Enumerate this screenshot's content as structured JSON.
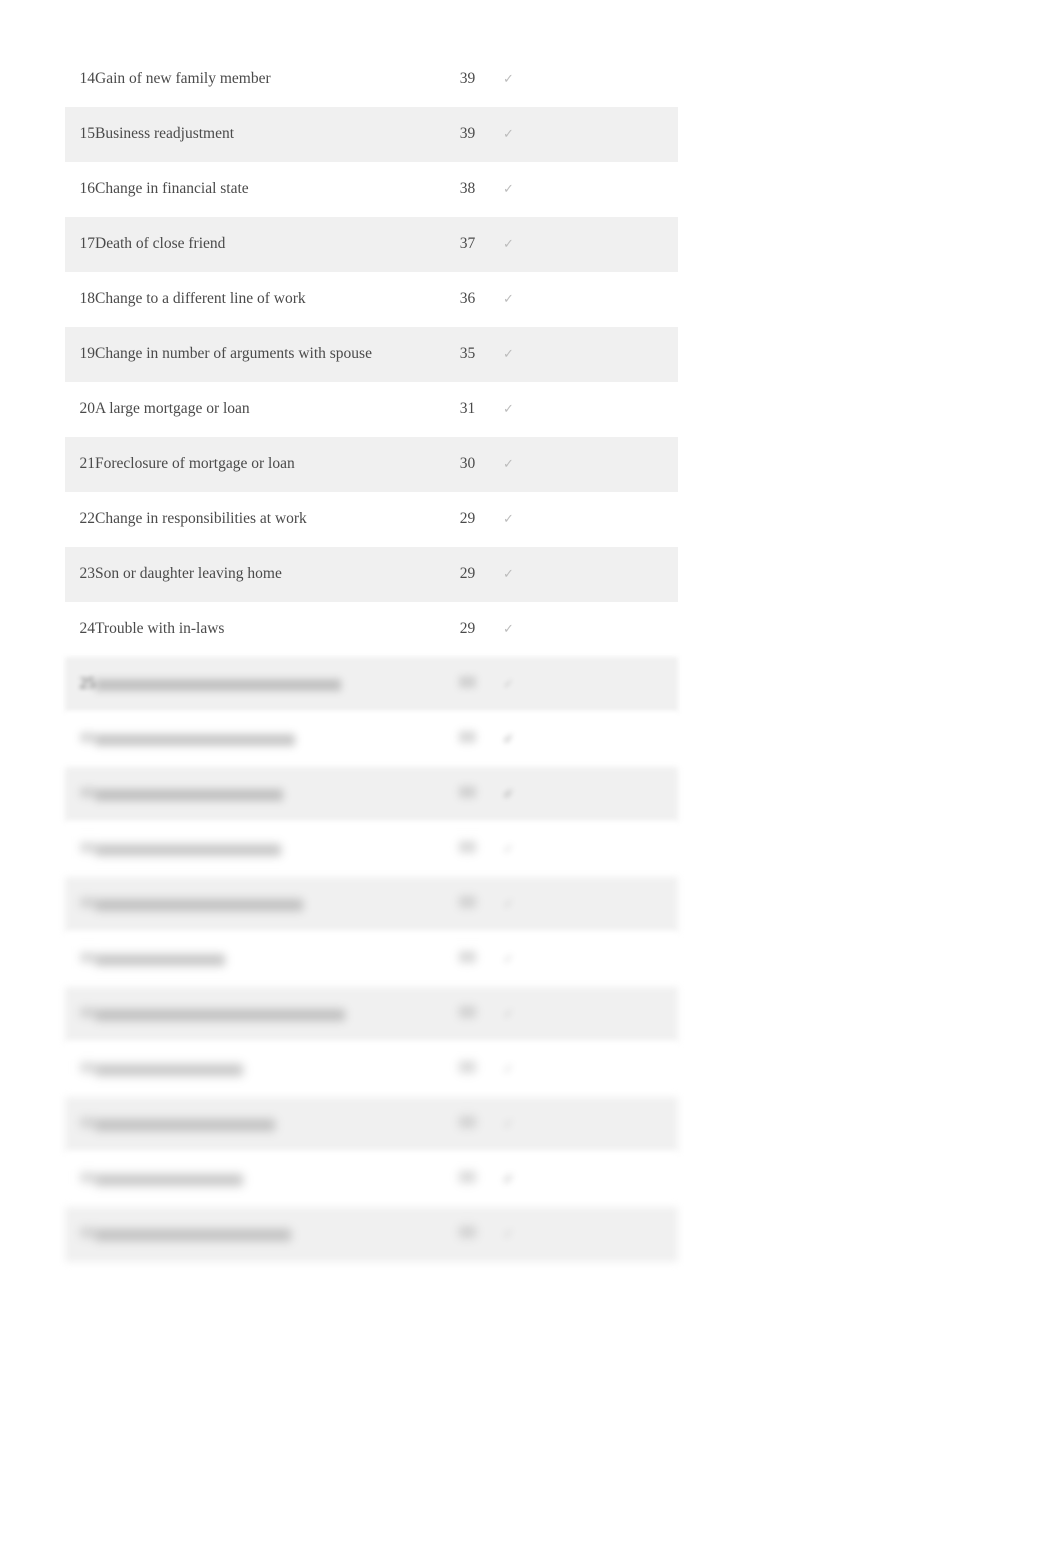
{
  "page": {
    "background_color": "#ffffff",
    "table_background_odd": "#ffffff",
    "table_background_even": "#f0f0f0",
    "text_color": "#4a4a4a"
  },
  "table": {
    "name": "stress-inventory-table",
    "columns": [
      "index",
      "life_event",
      "score",
      "checkbox"
    ],
    "rows": [
      {
        "index": "14",
        "event": "Gain of new family member",
        "score": "39",
        "checked": false,
        "legible": true,
        "blur": 0
      },
      {
        "index": "15",
        "event": "Business readjustment",
        "score": "39",
        "checked": false,
        "legible": true,
        "blur": 0
      },
      {
        "index": "16",
        "event": "Change in financial state",
        "score": "38",
        "checked": false,
        "legible": true,
        "blur": 0
      },
      {
        "index": "17",
        "event": "Death of close friend",
        "score": "37",
        "checked": false,
        "legible": true,
        "blur": 0
      },
      {
        "index": "18",
        "event": "Change to a different line of work",
        "score": "36",
        "checked": false,
        "legible": true,
        "blur": 0
      },
      {
        "index": "19",
        "event": "Change in number of arguments with spouse",
        "score": "35",
        "checked": false,
        "legible": true,
        "blur": 0
      },
      {
        "index": "20",
        "event": "A large mortgage or loan",
        "score": "31",
        "checked": false,
        "legible": true,
        "blur": 0
      },
      {
        "index": "21",
        "event": "Foreclosure of mortgage or loan",
        "score": "30",
        "checked": false,
        "legible": true,
        "blur": 0
      },
      {
        "index": "22",
        "event": "Change in responsibilities at work",
        "score": "29",
        "checked": false,
        "legible": true,
        "blur": 0
      },
      {
        "index": "23",
        "event": "Son or daughter leaving home",
        "score": "29",
        "checked": false,
        "legible": true,
        "blur": 0
      },
      {
        "index": "24",
        "event": "Trouble with in-laws",
        "score": "29",
        "checked": false,
        "legible": true,
        "blur": 0
      },
      {
        "index": "25",
        "event": "",
        "score": "",
        "checked": false,
        "legible": false,
        "blur": 1,
        "event_bar_width": 246,
        "index_legible": true
      },
      {
        "index": "",
        "event": "",
        "score": "",
        "checked": true,
        "legible": false,
        "blur": 2,
        "event_bar_width": 200,
        "index_legible": false
      },
      {
        "index": "",
        "event": "",
        "score": "",
        "checked": true,
        "legible": false,
        "blur": 2,
        "event_bar_width": 188,
        "index_legible": false
      },
      {
        "index": "",
        "event": "",
        "score": "",
        "checked": false,
        "legible": false,
        "blur": 3,
        "event_bar_width": 186,
        "index_legible": false
      },
      {
        "index": "",
        "event": "",
        "score": "",
        "checked": false,
        "legible": false,
        "blur": 3,
        "event_bar_width": 208,
        "index_legible": false
      },
      {
        "index": "",
        "event": "",
        "score": "",
        "checked": false,
        "legible": false,
        "blur": 3,
        "event_bar_width": 130,
        "index_legible": false
      },
      {
        "index": "",
        "event": "",
        "score": "",
        "checked": false,
        "legible": false,
        "blur": 3,
        "event_bar_width": 250,
        "index_legible": false
      },
      {
        "index": "",
        "event": "",
        "score": "",
        "checked": false,
        "legible": false,
        "blur": 4,
        "event_bar_width": 148,
        "index_legible": false
      },
      {
        "index": "",
        "event": "",
        "score": "",
        "checked": false,
        "legible": false,
        "blur": 4,
        "event_bar_width": 180,
        "index_legible": false
      },
      {
        "index": "",
        "event": "",
        "score": "",
        "checked": true,
        "legible": false,
        "blur": 4,
        "event_bar_width": 148,
        "index_legible": false
      },
      {
        "index": "",
        "event": "",
        "score": "",
        "checked": false,
        "legible": false,
        "blur": 4,
        "event_bar_width": 196,
        "index_legible": false
      }
    ]
  },
  "icons": {
    "checkbox_empty": "✓",
    "checkbox_filled": "✓"
  }
}
